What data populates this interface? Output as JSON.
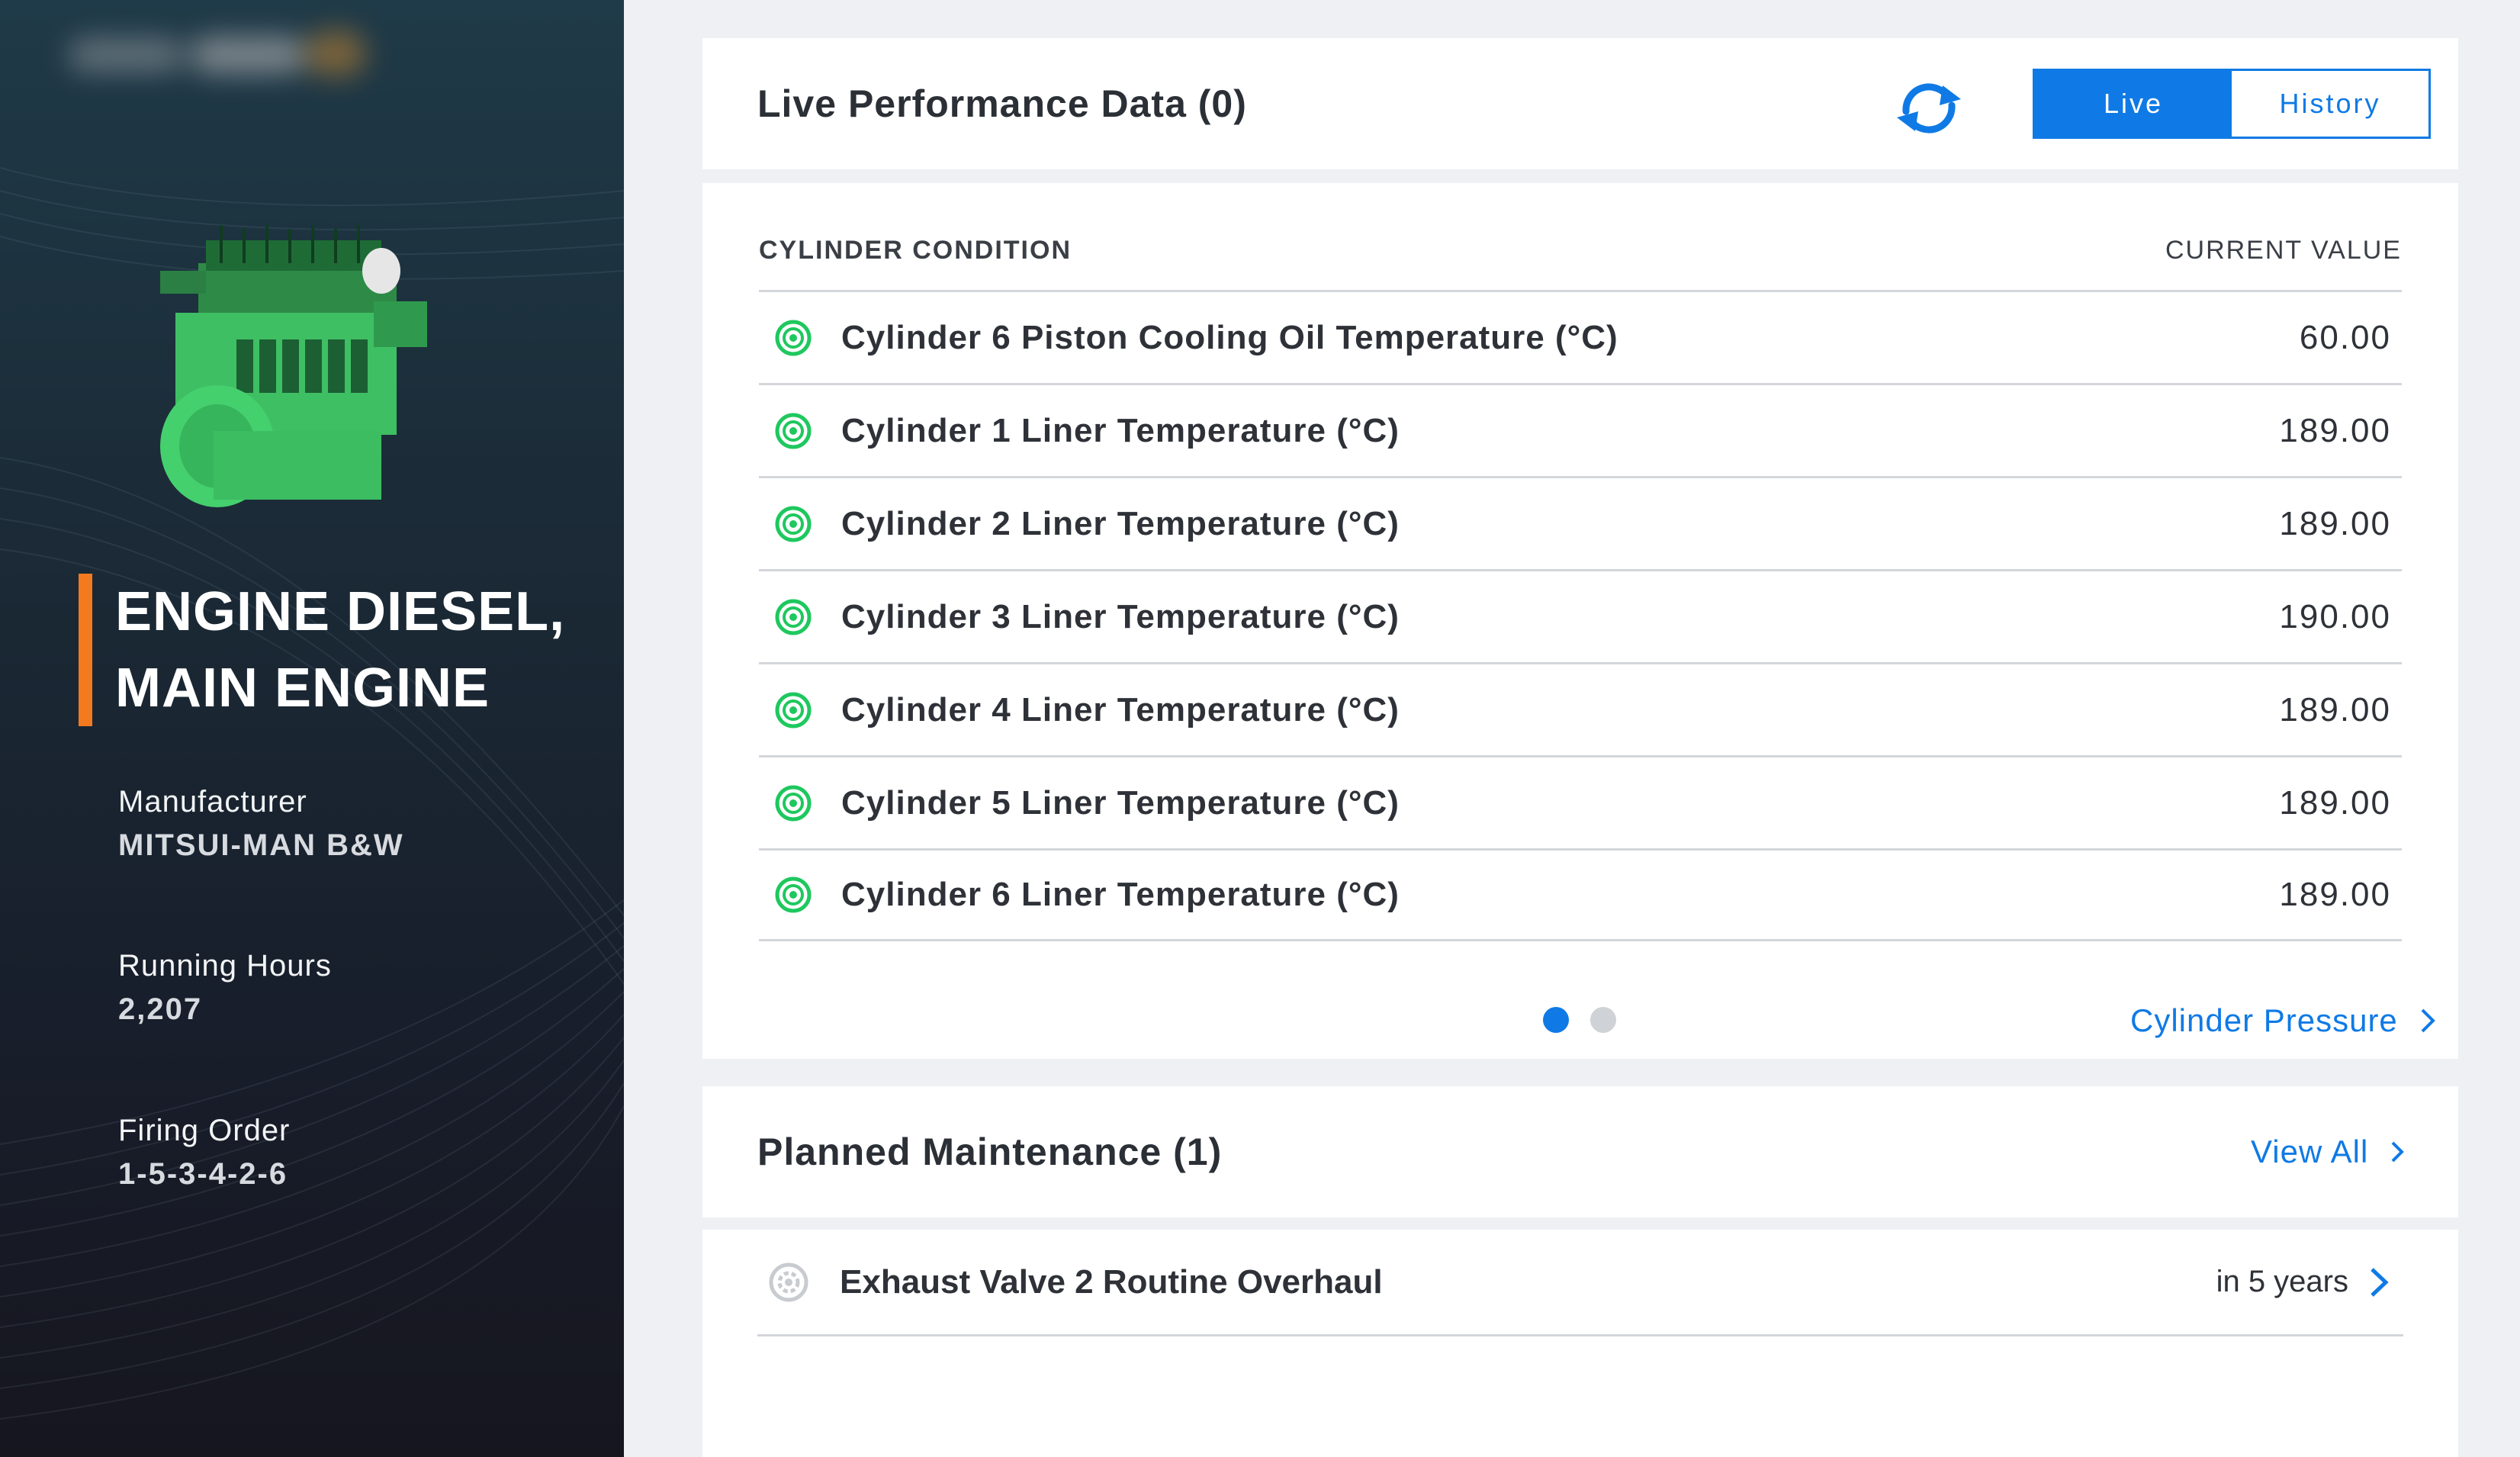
{
  "sidebar": {
    "title_line1": "ENGINE DIESEL,",
    "title_line2": "MAIN ENGINE",
    "manufacturer_label": "Manufacturer",
    "manufacturer_value": "MITSUI-MAN B&W",
    "running_hours_label": "Running Hours",
    "running_hours_value": "2,207",
    "firing_order_label": "Firing Order",
    "firing_order_value": "1-5-3-4-2-6",
    "accent_color": "#f47a1f"
  },
  "live": {
    "title": "Live Performance Data (0)",
    "toggle_live": "Live",
    "toggle_history": "History",
    "active_toggle": "Live",
    "col_left": "CYLINDER CONDITION",
    "col_right": "CURRENT VALUE",
    "rows": [
      {
        "name": "Cylinder 6 Piston Cooling Oil Temperature (°C)",
        "value": "60.00",
        "status": "ok"
      },
      {
        "name": "Cylinder 1 Liner Temperature (°C)",
        "value": "189.00",
        "status": "ok"
      },
      {
        "name": "Cylinder 2 Liner Temperature (°C)",
        "value": "189.00",
        "status": "ok"
      },
      {
        "name": "Cylinder 3 Liner Temperature (°C)",
        "value": "190.00",
        "status": "ok"
      },
      {
        "name": "Cylinder 4 Liner Temperature (°C)",
        "value": "189.00",
        "status": "ok"
      },
      {
        "name": "Cylinder 5 Liner Temperature (°C)",
        "value": "189.00",
        "status": "ok"
      },
      {
        "name": "Cylinder 6 Liner Temperature (°C)",
        "value": "189.00",
        "status": "ok"
      }
    ],
    "pagination": {
      "current_page": 1,
      "total_pages": 2
    },
    "next_link": "Cylinder Pressure"
  },
  "maintenance": {
    "title": "Planned Maintenance (1)",
    "view_all": "View All",
    "items": [
      {
        "name": "Exhaust Valve 2 Routine Overhaul",
        "due": "in 5 years"
      }
    ]
  },
  "colors": {
    "accent_blue": "#0f7ae5",
    "status_ok": "#1ec85e",
    "status_neutral": "#c8cbcf"
  }
}
